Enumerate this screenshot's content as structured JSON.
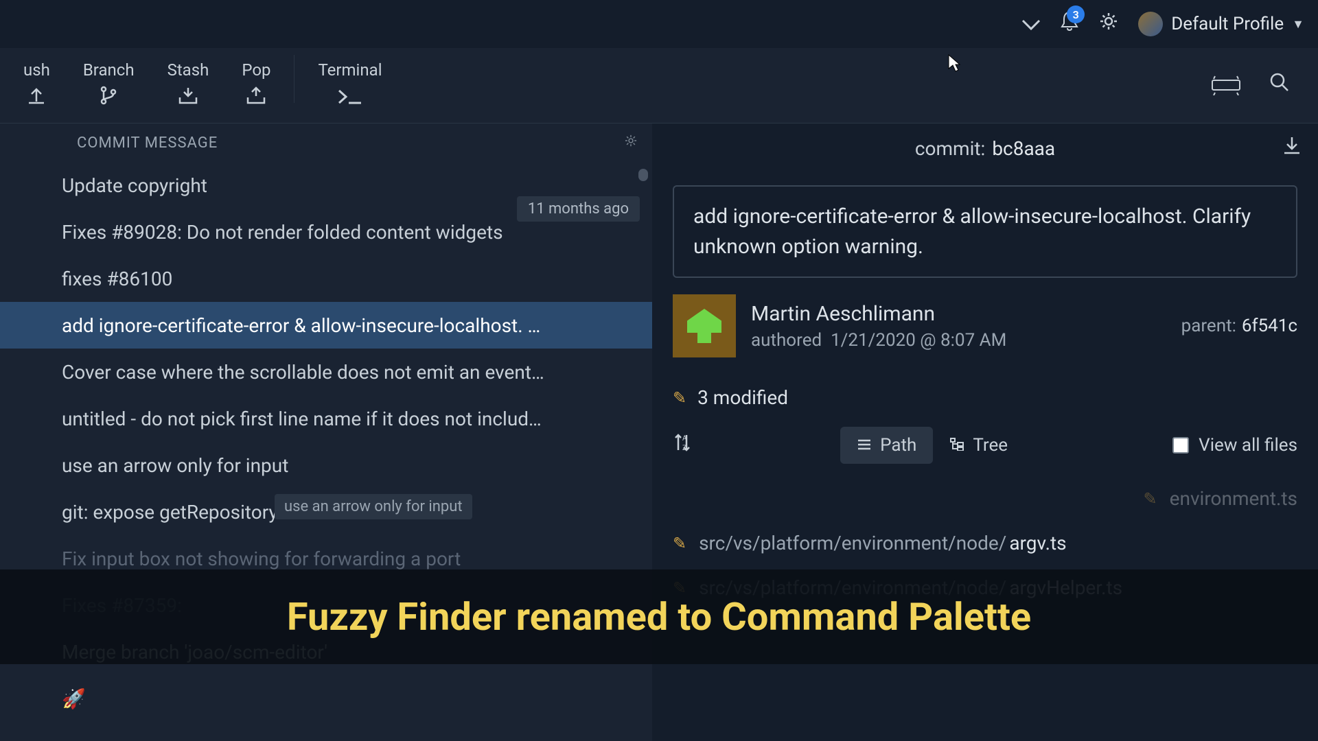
{
  "header": {
    "notification_count": "3",
    "profile_label": "Default Profile"
  },
  "toolbar": {
    "push": "ush",
    "branch": "Branch",
    "stash": "Stash",
    "pop": "Pop",
    "terminal": "Terminal"
  },
  "commit_list": {
    "header": "COMMIT MESSAGE",
    "time_label": "11 months ago",
    "tooltip": "use an arrow only for input",
    "items": [
      {
        "msg": "Update copyright"
      },
      {
        "msg": "Fixes #89028: Do not render folded content widgets"
      },
      {
        "msg": "fixes #86100"
      },
      {
        "msg": "add ignore-certificate-error & allow-insecure-localhost. …",
        "selected": true
      },
      {
        "msg": "Cover case where the scrollable does not emit an event…"
      },
      {
        "msg": "untitled - do not pick first line name if it does not includ…"
      },
      {
        "msg": "use an arrow only for input"
      },
      {
        "msg": "git: expose getRepository"
      },
      {
        "msg": "Fix input box not showing for forwarding a port",
        "fade": true
      },
      {
        "msg": "Fixes #87359:",
        "fade": true
      },
      {
        "msg": "Merge branch 'joao/scm-editor'"
      },
      {
        "msg": "🚀"
      }
    ]
  },
  "detail": {
    "commit_label": "commit:",
    "commit_hash": "bc8aaa",
    "full_message": "add ignore-certificate-error & allow-insecure-localhost. Clarify unknown option warning.",
    "author_name": "Martin Aeschlimann",
    "authored_label": "authored",
    "authored_date": "1/21/2020 @ 8:07 AM",
    "parent_label": "parent:",
    "parent_hash": "6f541c",
    "modified_label": "3 modified",
    "path_btn": "Path",
    "tree_btn": "Tree",
    "view_all": "View all files",
    "files": [
      {
        "dir": "environment.ts",
        "prefix": ""
      },
      {
        "dir": "src/vs/platform/environment/node/",
        "name": "argv.ts"
      },
      {
        "dir": "src/vs/platform/environment/node/",
        "name": "argvHelper.ts"
      }
    ]
  },
  "overlay": {
    "text": "Fuzzy Finder renamed to Command Palette"
  }
}
